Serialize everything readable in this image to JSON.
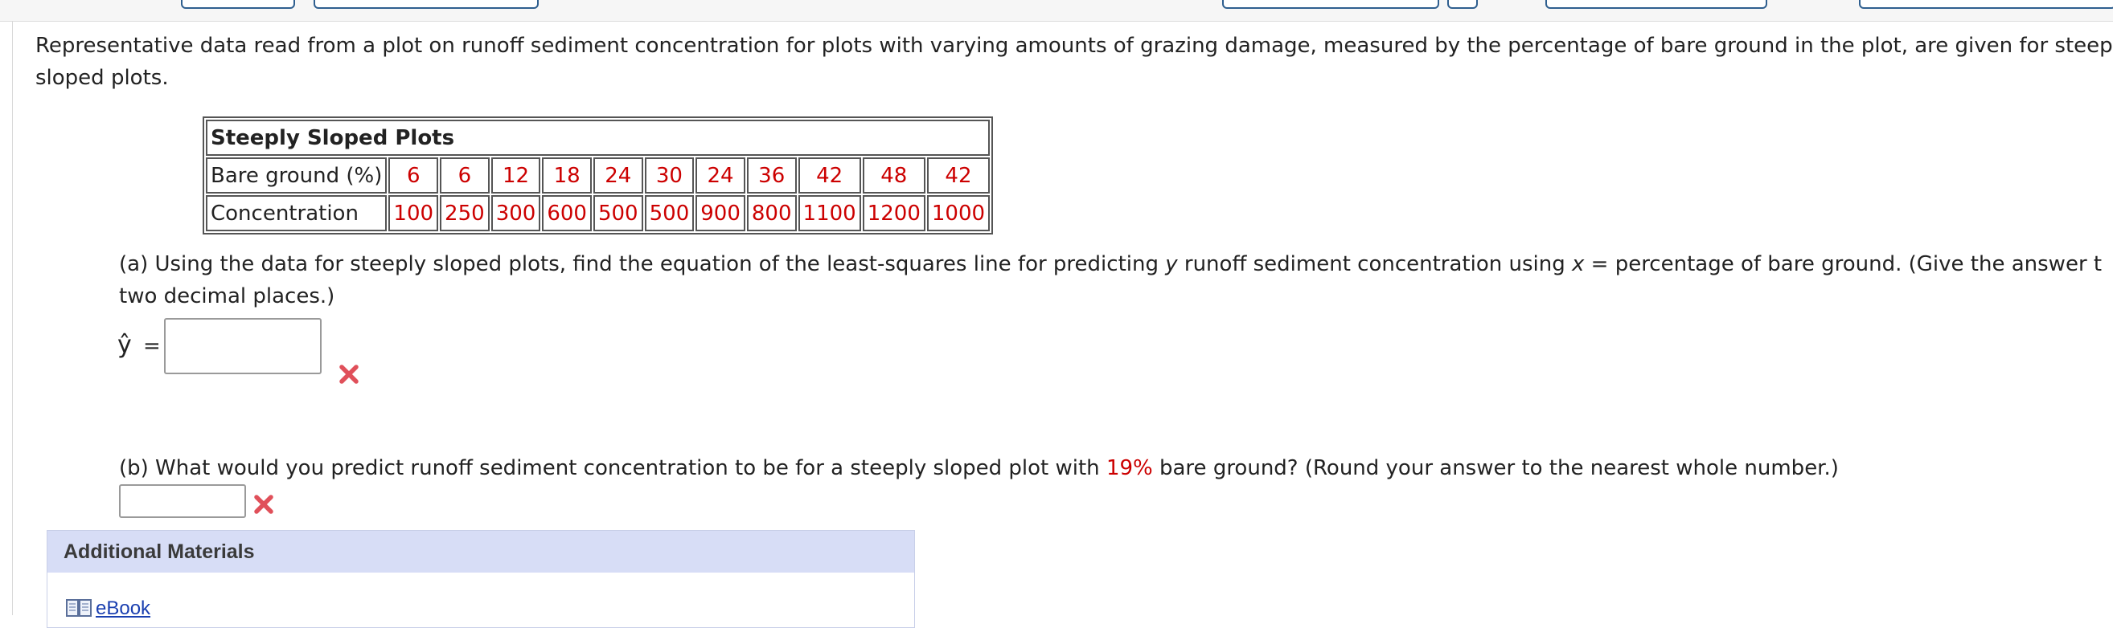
{
  "intro": {
    "line1": "Representative data read from a plot on runoff sediment concentration for plots with varying amounts of grazing damage, measured by the percentage of bare ground in the plot, are given for steep",
    "line2": "sloped plots."
  },
  "table": {
    "title": "Steeply Sloped Plots",
    "row1_label": "Bare ground (%)",
    "row1_values": [
      "6",
      "6",
      "12",
      "18",
      "24",
      "30",
      "24",
      "36",
      "42",
      "48",
      "42"
    ],
    "row2_label": "Concentration",
    "row2_values": [
      "100",
      "250",
      "300",
      "600",
      "500",
      "500",
      "900",
      "800",
      "1100",
      "1200",
      "1000"
    ]
  },
  "part_a": {
    "line1_pre": "(a) Using the data for steeply sloped plots, find the equation of the least-squares line for predicting ",
    "var_y": "y",
    "line1_mid": " runoff sediment concentration using ",
    "var_x": "x",
    "line1_post": " = percentage of bare ground. (Give the answer t",
    "line2": "two decimal places.)",
    "yhat_symbol": "ŷ",
    "equals": "=",
    "answer_value": "",
    "status_icon": "x-mark-icon",
    "status_color": "#e0505a"
  },
  "part_b": {
    "pre": "(b) What would you predict runoff sediment concentration to be for a steeply sloped plot with ",
    "highlight": "19%",
    "post": " bare ground? (Round your answer to the nearest whole number.)",
    "answer_value": "",
    "status_icon": "x-mark-icon",
    "highlight_color": "#cc0000"
  },
  "additional_materials": {
    "header": "Additional Materials",
    "link_label": "eBook",
    "link_icon": "book-icon"
  }
}
